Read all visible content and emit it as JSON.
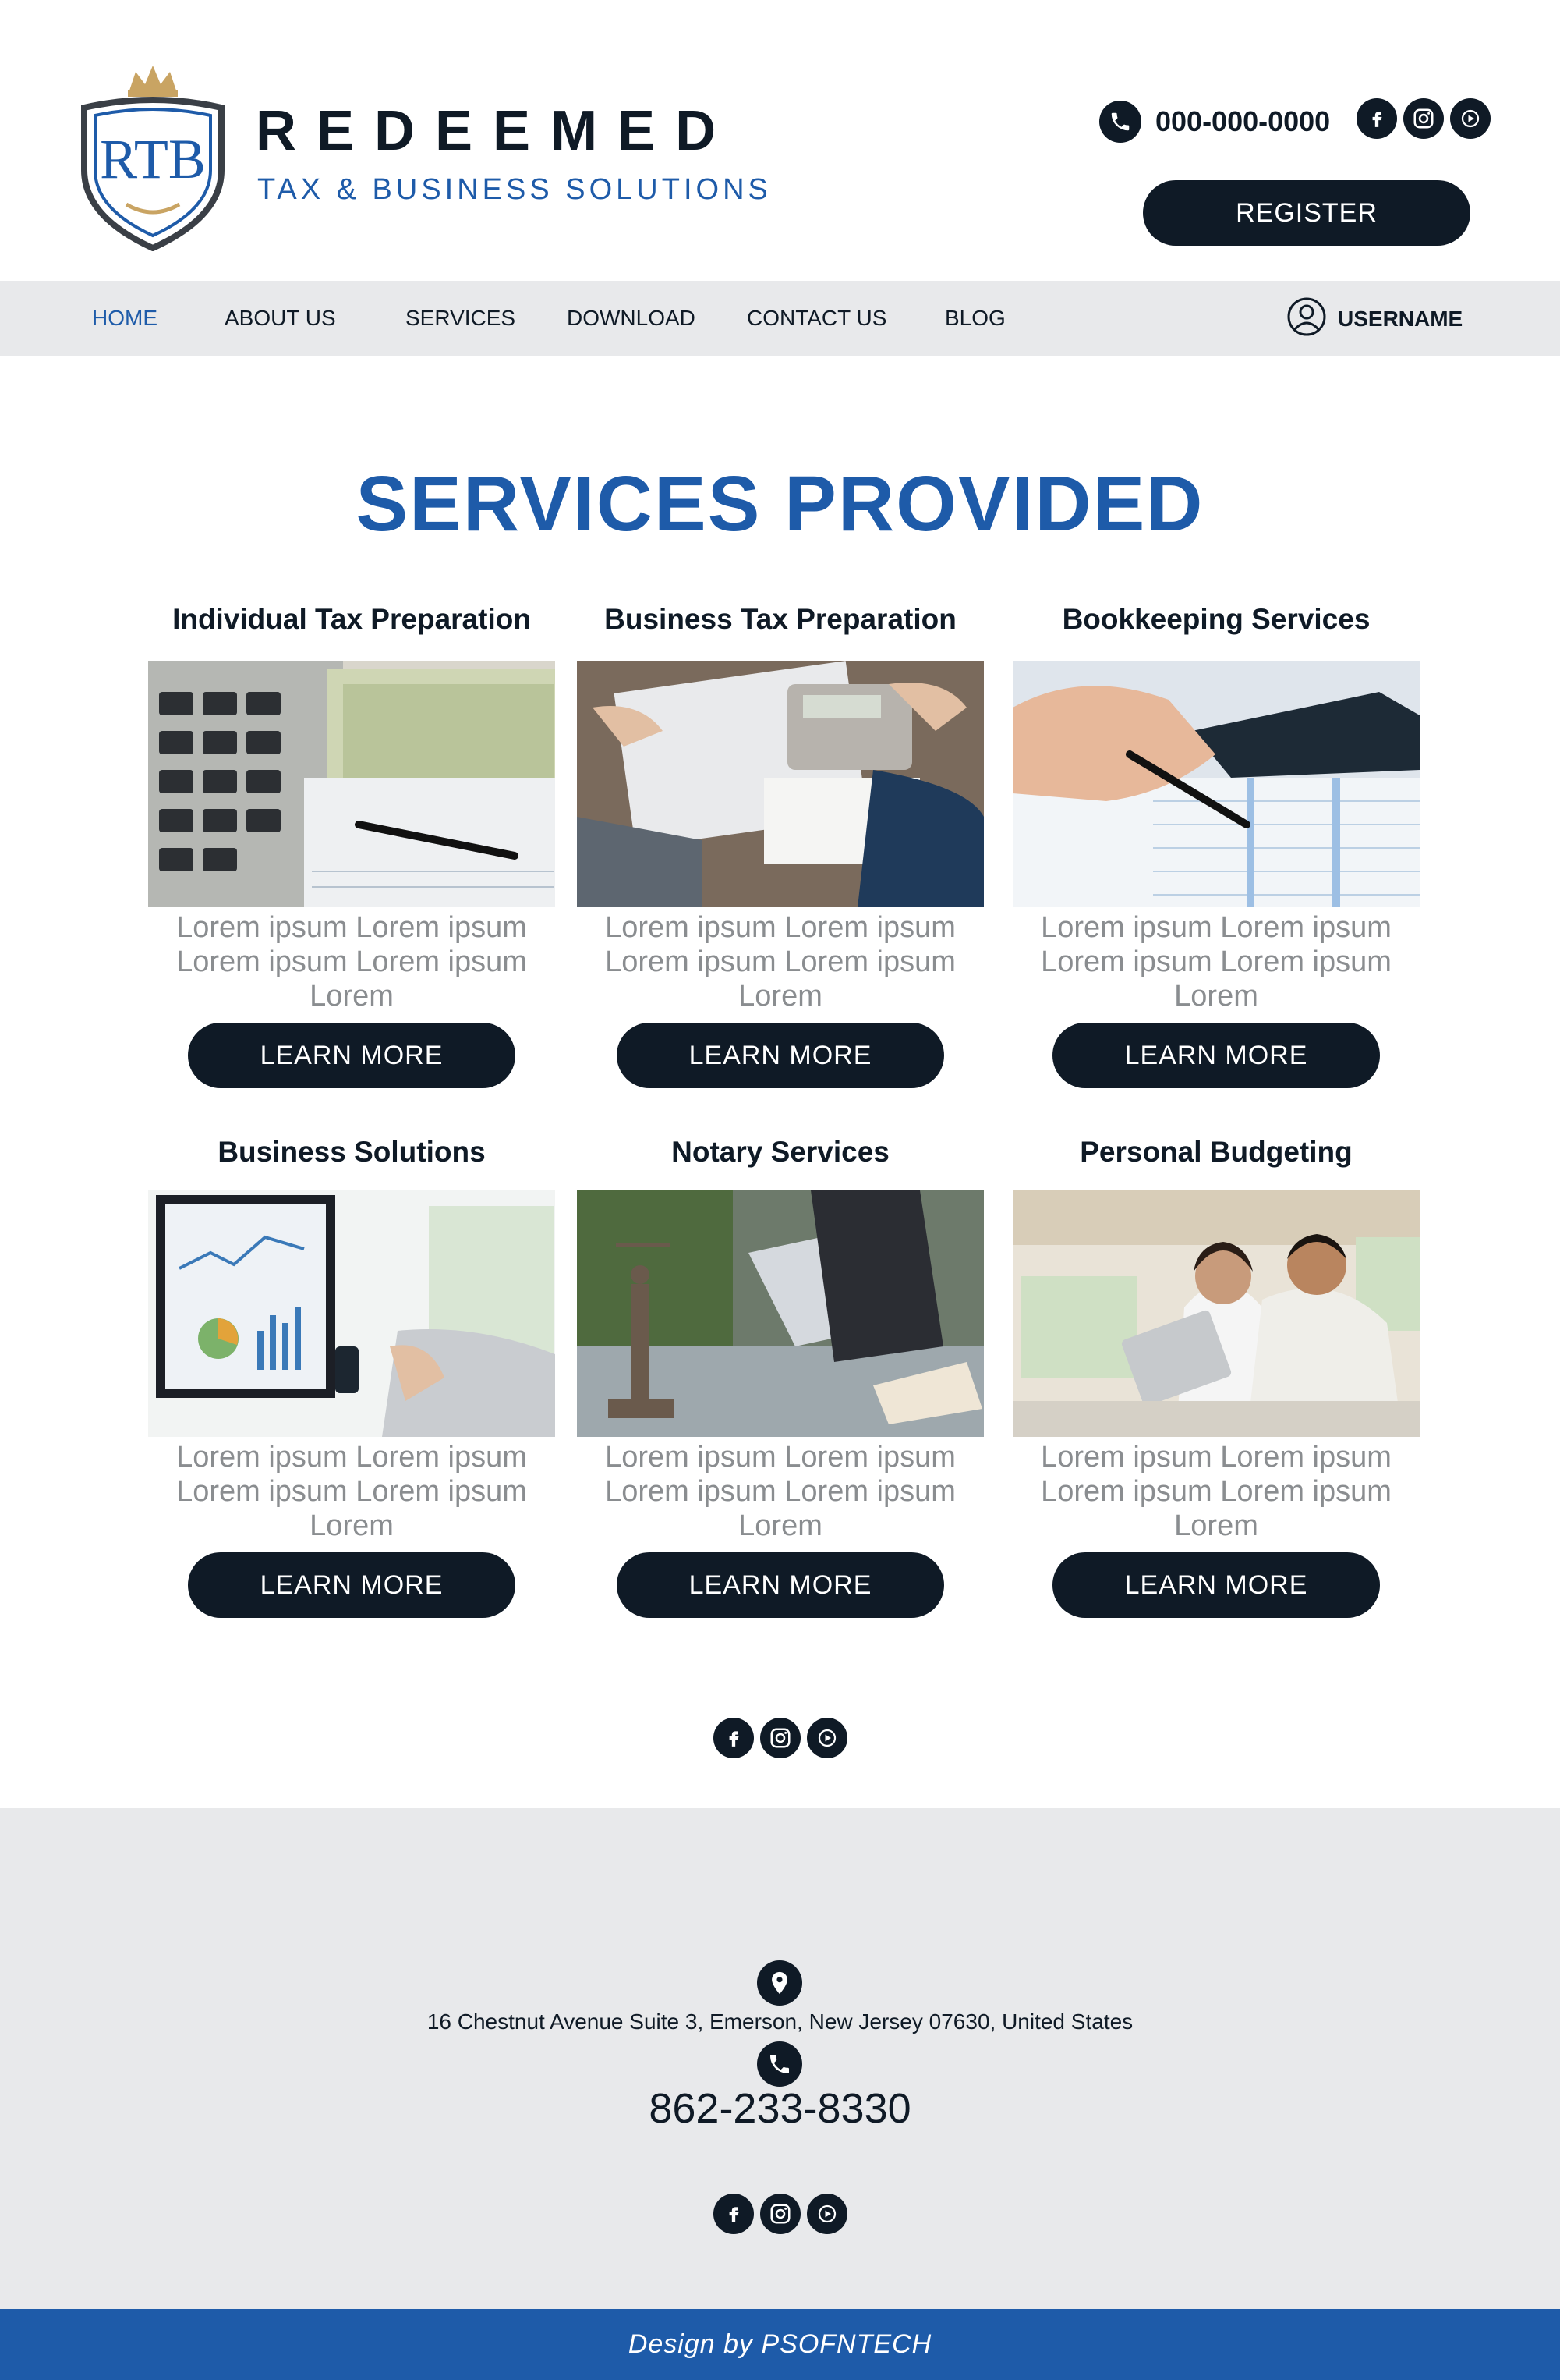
{
  "brand": {
    "monogram": "RTB",
    "name": "REDEEMED",
    "tagline": "TAX & BUSINESS SOLUTIONS",
    "primary_color": "#1e5ba9",
    "dark_color": "#0f1a26",
    "gold_color": "#c9a463"
  },
  "header": {
    "phone": "000-000-0000",
    "register_label": "REGISTER",
    "social_icons": [
      "facebook-icon",
      "instagram-icon",
      "youtube-icon"
    ]
  },
  "nav": {
    "items": [
      {
        "label": "HOME",
        "active": true
      },
      {
        "label": "ABOUT US"
      },
      {
        "label": "SERVICES"
      },
      {
        "label": "DOWNLOAD"
      },
      {
        "label": "CONTACT US"
      },
      {
        "label": "BLOG"
      }
    ],
    "username": "USERNAME"
  },
  "services": {
    "title": "SERVICES PROVIDED",
    "cards": [
      {
        "title": "Individual Tax Preparation",
        "text": "Lorem ipsum Lorem ipsum Lorem ipsum Lorem ipsum Lorem",
        "button": "LEARN MORE",
        "image": "calculator-and-dollar-bills"
      },
      {
        "title": "Business Tax Preparation",
        "text": "Lorem ipsum Lorem ipsum Lorem ipsum Lorem ipsum Lorem",
        "button": "LEARN MORE",
        "image": "hands-with-calculator-and-documents"
      },
      {
        "title": "Bookkeeping Services",
        "text": "Lorem ipsum Lorem ipsum Lorem ipsum Lorem ipsum Lorem",
        "button": "LEARN MORE",
        "image": "hand-with-pen-and-ledger"
      },
      {
        "title": "Business Solutions",
        "text": "Lorem ipsum Lorem ipsum Lorem ipsum Lorem ipsum Lorem",
        "button": "LEARN MORE",
        "image": "monitor-with-charts"
      },
      {
        "title": "Notary Services",
        "text": "Lorem ipsum Lorem ipsum Lorem ipsum Lorem ipsum Lorem",
        "button": "LEARN MORE",
        "image": "lady-justice-statue-and-laptop"
      },
      {
        "title": "Personal Budgeting",
        "text": "Lorem ipsum Lorem ipsum Lorem ipsum Lorem ipsum Lorem",
        "button": "LEARN MORE",
        "image": "smiling-couple-with-tablet"
      }
    ]
  },
  "footer": {
    "address": "16 Chestnut Avenue Suite 3, Emerson, New Jersey 07630, United States",
    "phone": "862-233-8330",
    "credit": "Design by PSOFNTECH"
  }
}
